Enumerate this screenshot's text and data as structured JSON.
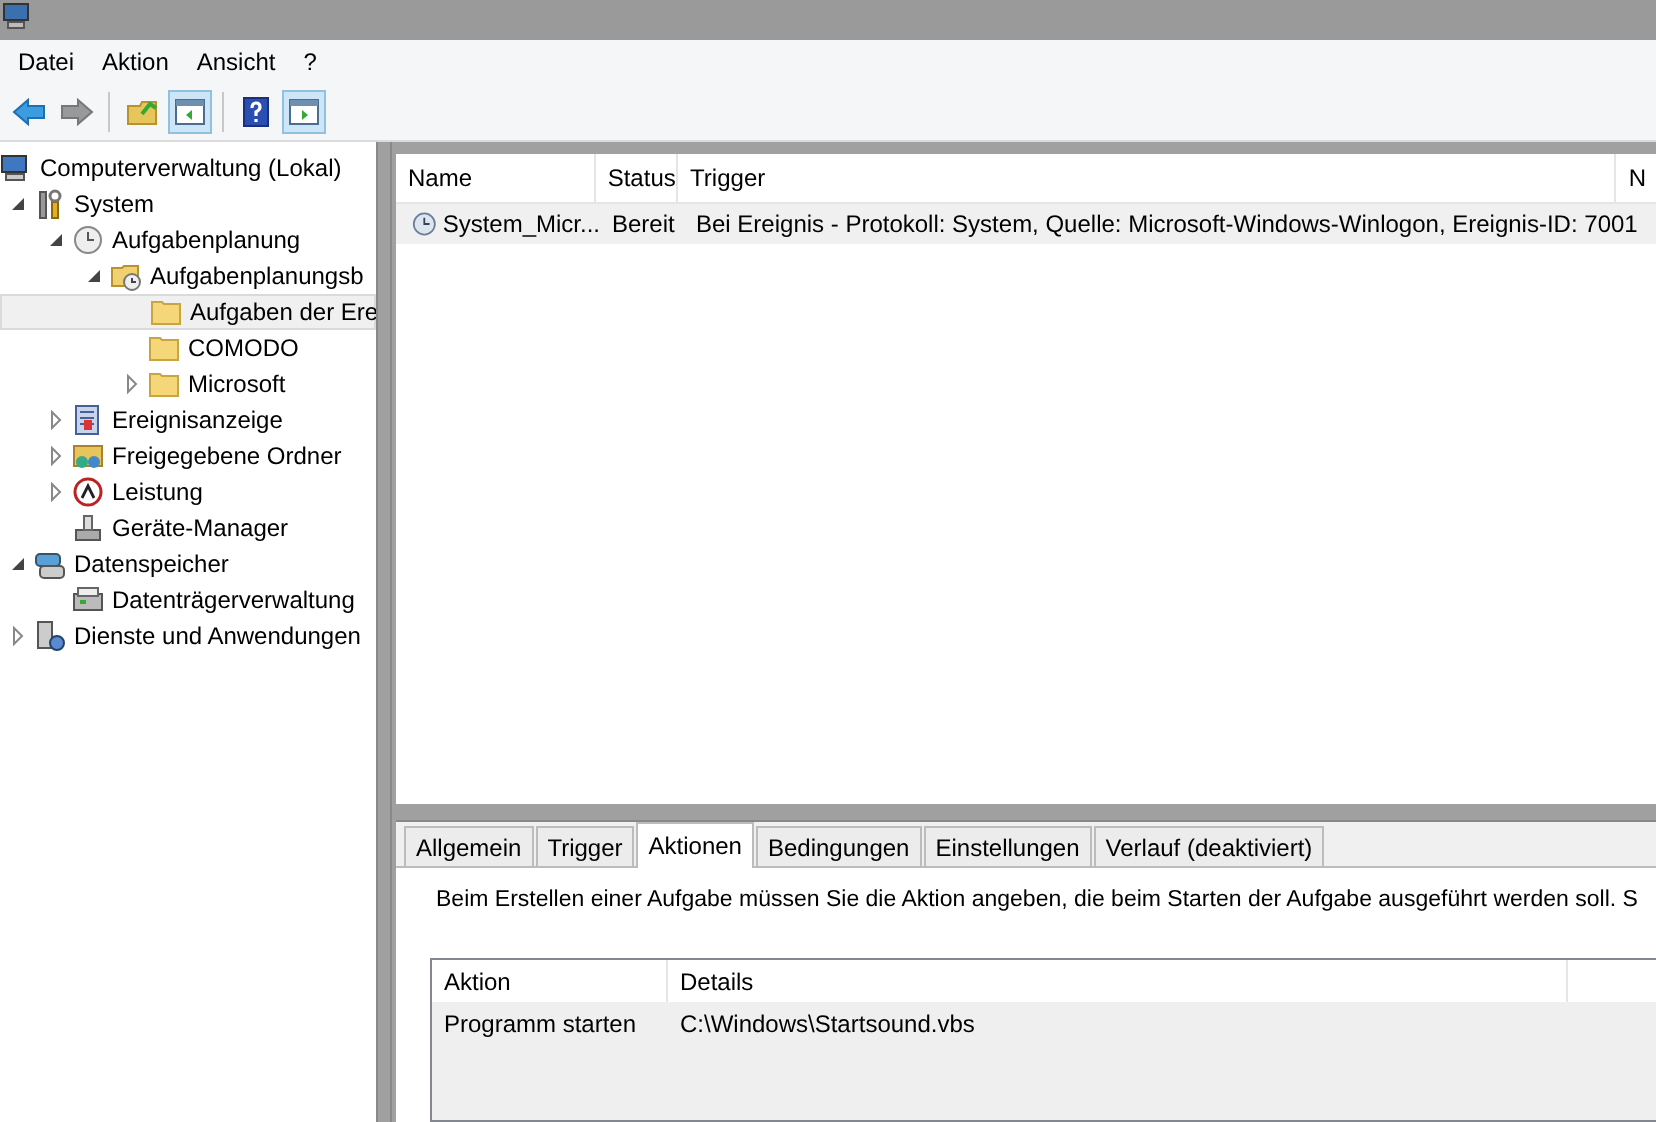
{
  "menu": [
    "Datei",
    "Aktion",
    "Ansicht",
    "?"
  ],
  "toolbar": [
    {
      "kind": "back",
      "pressed": false
    },
    {
      "kind": "forward",
      "pressed": false
    },
    {
      "kind": "sep"
    },
    {
      "kind": "up",
      "pressed": false
    },
    {
      "kind": "pane-left",
      "pressed": true
    },
    {
      "kind": "sep"
    },
    {
      "kind": "help",
      "pressed": false
    },
    {
      "kind": "pane-right",
      "pressed": true
    }
  ],
  "tree": [
    {
      "label": "Computerverwaltung (Lokal)",
      "kind": "computer",
      "selected": false,
      "children": [
        {
          "label": "System",
          "kind": "tools",
          "expanded": true,
          "selected": false,
          "children": [
            {
              "label": "Aufgabenplanung",
              "kind": "clock",
              "expanded": true,
              "selected": false,
              "children": [
                {
                  "label": "Aufgabenplanungsb",
                  "kind": "folder-clock",
                  "expanded": true,
                  "selected": false,
                  "children": [
                    {
                      "label": "Aufgaben der Ere",
                      "kind": "folder",
                      "selected": true
                    },
                    {
                      "label": "COMODO",
                      "kind": "folder",
                      "selected": false
                    },
                    {
                      "label": "Microsoft",
                      "kind": "folder",
                      "expanded": false,
                      "selected": false
                    }
                  ]
                }
              ]
            },
            {
              "label": "Ereignisanzeige",
              "kind": "event",
              "expanded": false,
              "selected": false
            },
            {
              "label": "Freigegebene Ordner",
              "kind": "share",
              "expanded": false,
              "selected": false
            },
            {
              "label": "Leistung",
              "kind": "perf",
              "expanded": false,
              "selected": false
            },
            {
              "label": "Geräte-Manager",
              "kind": "device",
              "selected": false
            }
          ]
        },
        {
          "label": "Datenspeicher",
          "kind": "storage",
          "expanded": true,
          "selected": false,
          "children": [
            {
              "label": "Datenträgerverwaltung",
              "kind": "disk",
              "selected": false
            }
          ]
        },
        {
          "label": "Dienste und Anwendungen",
          "kind": "services",
          "expanded": false,
          "selected": false
        }
      ]
    }
  ],
  "task_list": {
    "columns": [
      "Name",
      "Status",
      "Trigger",
      "N"
    ],
    "rows": [
      {
        "name": "System_Micr...",
        "status": "Bereit",
        "trigger": "Bei Ereignis - Protokoll: System, Quelle: Microsoft-Windows-Winlogon, Ereignis-ID: 7001",
        "selected": true
      }
    ]
  },
  "tabs": [
    {
      "label": "Allgemein",
      "selected": false
    },
    {
      "label": "Trigger",
      "selected": false
    },
    {
      "label": "Aktionen",
      "selected": true
    },
    {
      "label": "Bedingungen",
      "selected": false
    },
    {
      "label": "Einstellungen",
      "selected": false
    },
    {
      "label": "Verlauf (deaktiviert)",
      "selected": false
    }
  ],
  "description": "Beim Erstellen einer Aufgabe müssen Sie die Aktion angeben, die beim Starten der Aufgabe ausgeführt werden soll. S",
  "actions_table": {
    "columns": [
      "Aktion",
      "Details"
    ],
    "rows": [
      {
        "action": "Programm starten",
        "details": "C:\\Windows\\Startsound.vbs"
      }
    ]
  }
}
